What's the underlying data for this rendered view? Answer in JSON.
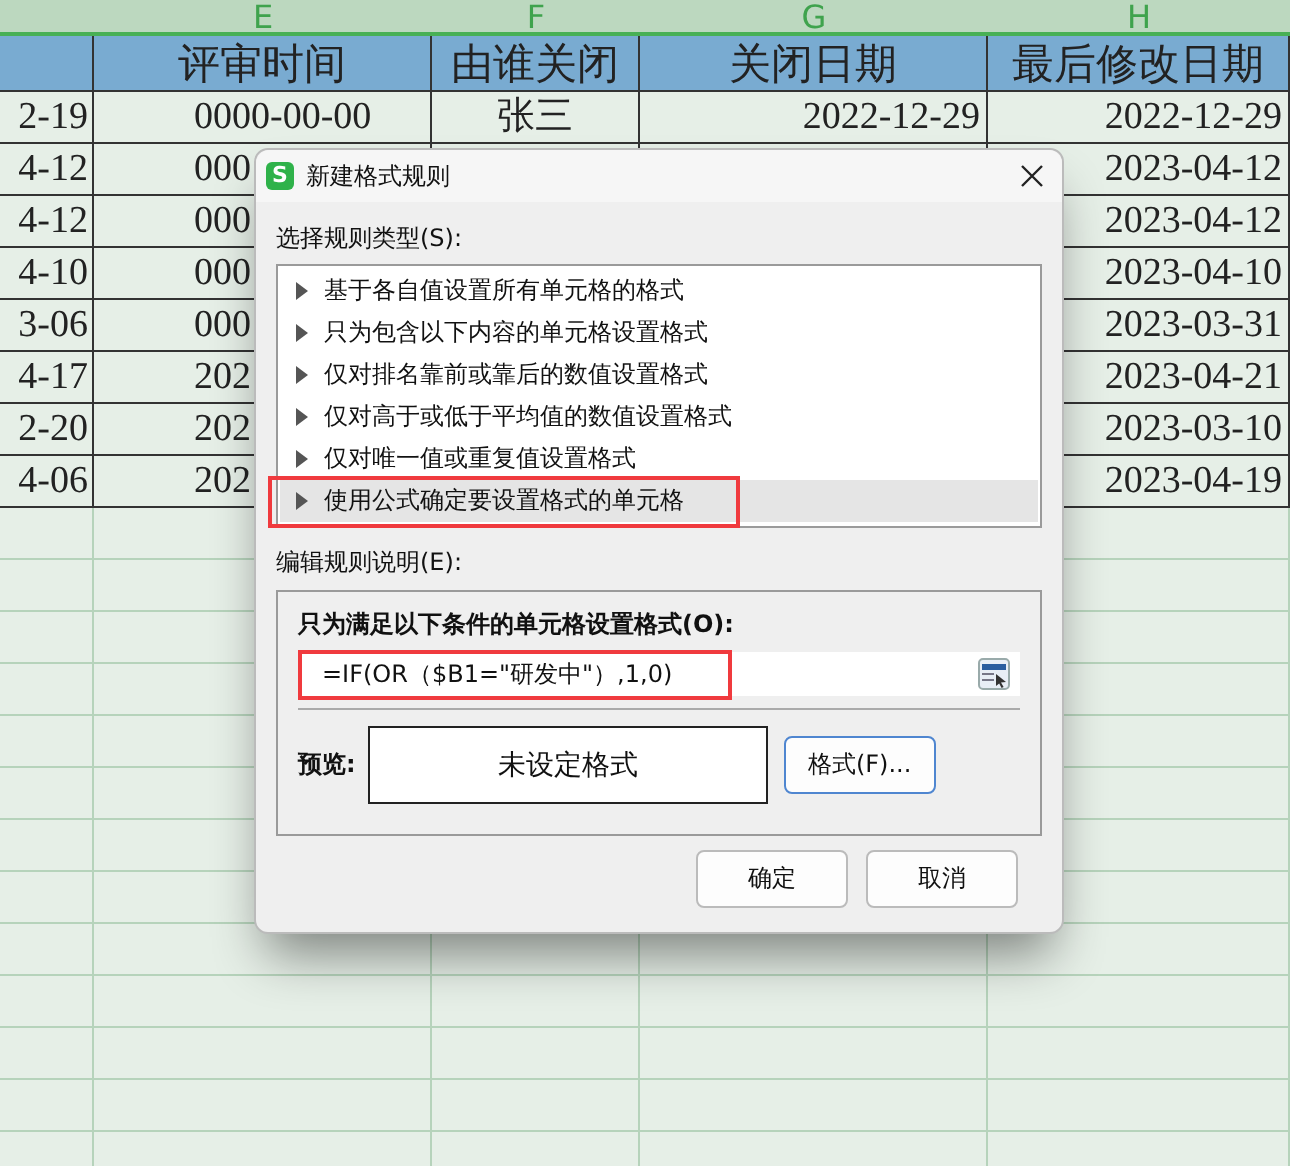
{
  "sheet": {
    "column_letters": [
      "E",
      "F",
      "G",
      "H"
    ],
    "headers": [
      "评审时间",
      "由谁关闭",
      "关闭日期",
      "最后修改日期"
    ],
    "rows": [
      {
        "partial": "2-19",
        "E": "0000-00-00",
        "F": "张三",
        "G": "2022-12-29",
        "H": "2022-12-29"
      },
      {
        "partial": "4-12",
        "E": "000",
        "H": "2023-04-12"
      },
      {
        "partial": "4-12",
        "E": "000",
        "H": "2023-04-12"
      },
      {
        "partial": "4-10",
        "E": "000",
        "H": "2023-04-10"
      },
      {
        "partial": "3-06",
        "E": "000",
        "H": "2023-03-31"
      },
      {
        "partial": "4-17",
        "E": "202",
        "H": "2023-04-21"
      },
      {
        "partial": "2-20",
        "E": "202",
        "H": "2023-03-10"
      },
      {
        "partial": "4-06",
        "E": "202",
        "H": "2023-04-19"
      }
    ]
  },
  "dialog": {
    "logo_text": "S",
    "title": "新建格式规则",
    "rule_type_label": "选择规则类型(S):",
    "rule_types": [
      {
        "label": "基于各自值设置所有单元格的格式",
        "selected": false,
        "annotated": false
      },
      {
        "label": "只为包含以下内容的单元格设置格式",
        "selected": false,
        "annotated": false
      },
      {
        "label": "仅对排名靠前或靠后的数值设置格式",
        "selected": false,
        "annotated": false
      },
      {
        "label": "仅对高于或低于平均值的数值设置格式",
        "selected": false,
        "annotated": false
      },
      {
        "label": "仅对唯一值或重复值设置格式",
        "selected": false,
        "annotated": false
      },
      {
        "label": "使用公式确定要设置格式的单元格",
        "selected": true,
        "annotated": true
      }
    ],
    "description_label": "编辑规则说明(E):",
    "condition_label": "只为满足以下条件的单元格设置格式(O):",
    "formula": {
      "value": "=IF(OR（$B1=\"研发中\"）,1,0)",
      "annotated": true
    },
    "preview_label": "预览:",
    "preview_text": "未设定格式",
    "format_button": "格式(F)...",
    "buttons": [
      "确定",
      "取消"
    ]
  }
}
